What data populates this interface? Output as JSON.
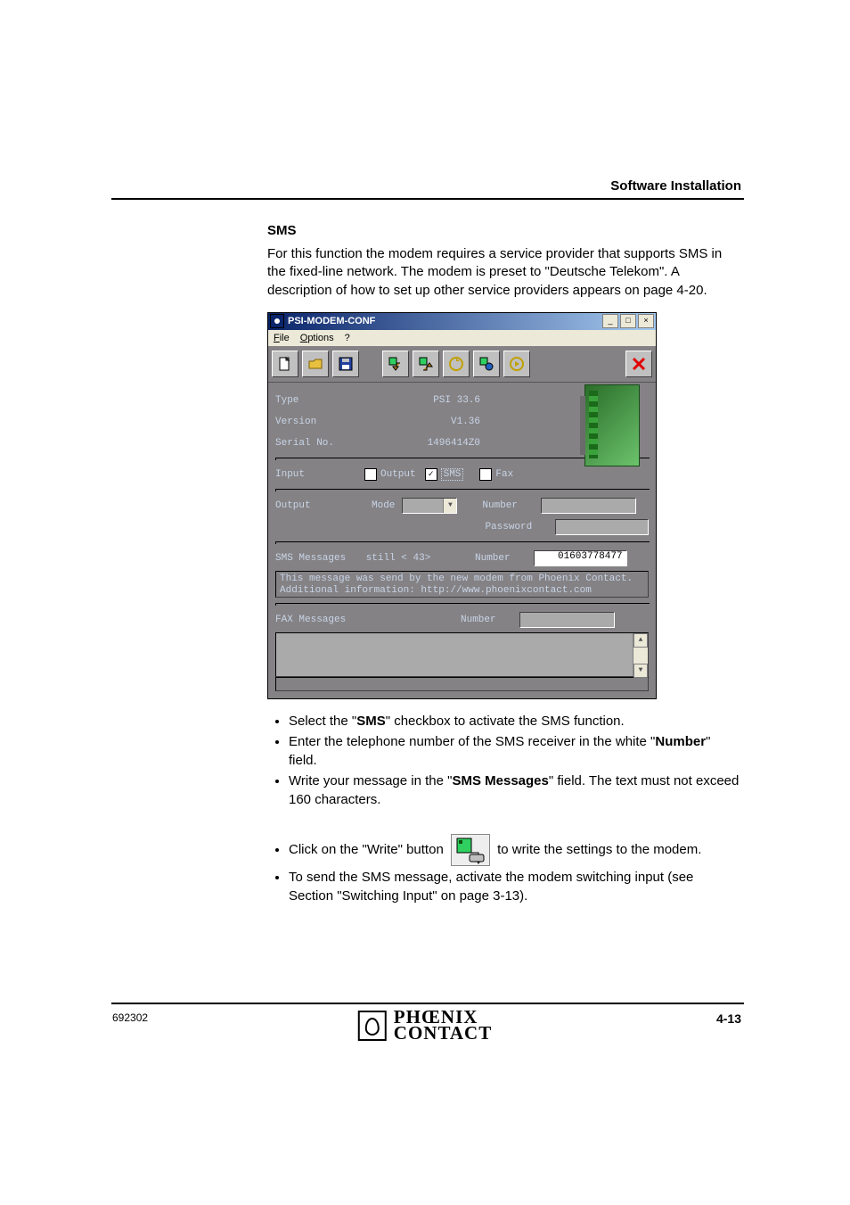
{
  "header": {
    "title": "Software Installation"
  },
  "section": {
    "heading": "SMS",
    "intro": "For this function the modem requires a service provider that supports SMS in the fixed-line network. The modem is preset to \"Deutsche Telekom\". A description of how to set up other service providers appears on page 4-20."
  },
  "window": {
    "title": "PSI-MODEM-CONF",
    "menu": {
      "file": "File",
      "options": "Options",
      "help": "?"
    },
    "toolbar_icons": [
      "new-icon",
      "open-icon",
      "save-icon",
      "read-icon",
      "write-icon",
      "sync-icon",
      "config-icon",
      "play-icon",
      "delete-icon"
    ],
    "info": {
      "type_label": "Type",
      "type_value": "PSI 33.6",
      "version_label": "Version",
      "version_value": "V1.36",
      "serial_label": "Serial No.",
      "serial_value": "1496414Z0"
    },
    "input": {
      "label": "Input",
      "output_cb": "Output",
      "output_checked": false,
      "sms_cb": "SMS",
      "sms_checked": true,
      "fax_cb": "Fax",
      "fax_checked": false
    },
    "output": {
      "label": "Output",
      "mode_label": "Mode",
      "number_label": "Number",
      "password_label": "Password",
      "mode_value": "",
      "number_value": "",
      "password_value": ""
    },
    "sms": {
      "label": "SMS Messages",
      "remaining": "still < 43>",
      "number_label": "Number",
      "number_value": "01603778477",
      "message": "This message was send by the new modem from Phoenix Contact. Additional information: http://www.phoenixcontact.com"
    },
    "fax": {
      "label": "FAX Messages",
      "number_label": "Number",
      "number_value": ""
    }
  },
  "bullets": {
    "b1_pre": "Select the \"",
    "b1_bold": "SMS",
    "b1_post": "\" checkbox to activate the SMS function.",
    "b2_pre": "Enter the telephone number of the SMS receiver in the white \"",
    "b2_bold": "Number",
    "b2_post": "\" field.",
    "b3_pre": "Write your message in the \"",
    "b3_bold": "SMS Messages",
    "b3_post": "\" field. The text must not exceed 160 characters.",
    "b4_pre": "Click on the \"Write\" button ",
    "b4_post": " to write the settings to the modem.",
    "b5": "To send the SMS message, activate the modem switching input (see Section \"Switching Input\" on page 3-13)."
  },
  "footer": {
    "left": "692302",
    "right": "4-13",
    "brand_top": "PHŒNIX",
    "brand_bot": "CONTACT"
  }
}
